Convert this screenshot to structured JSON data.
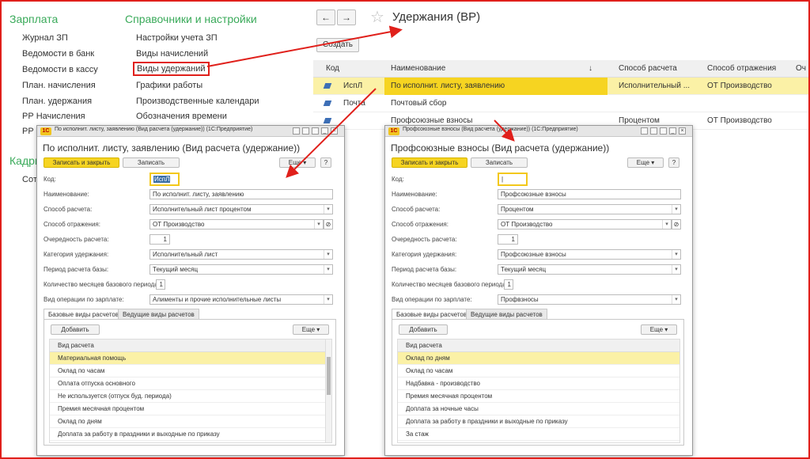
{
  "nav": {
    "section1": "Зарплата",
    "section2": "Справочники и настройки",
    "section3": "Кадры",
    "col1": [
      "Журнал ЗП",
      "Ведомости в банк",
      "Ведомости в кассу",
      "План. начисления",
      "План. удержания",
      "РР Начисления",
      "РР"
    ],
    "col1_last": "Сот",
    "col2": [
      "Настройки учета ЗП",
      "Виды начислений",
      "Виды удержаний",
      "Графики работы",
      "Производственные календари",
      "Обозначения времени"
    ]
  },
  "list": {
    "back": "←",
    "forward": "→",
    "title": "Удержания (ВР)",
    "create": "Создать",
    "headers": [
      "Код",
      "Наименование",
      "Способ расчета",
      "Способ отражения",
      "Оч"
    ],
    "sort_mark": "↓",
    "rows": [
      {
        "code": "ИспЛ",
        "name": "По исполнит. листу, заявлению",
        "method": "Исполнительный ...",
        "reflection": "ОТ Производство"
      },
      {
        "code": "Почта",
        "name": "Почтовый сбор",
        "method": "",
        "reflection": ""
      },
      {
        "code": "",
        "name": "Профсоюзные взносы",
        "method": "Процентом",
        "reflection": "ОТ Производство"
      }
    ]
  },
  "dlg1": {
    "titlebar": "По исполнит. листу, заявлению (Вид расчета (удержание))   (1С:Предприятие)",
    "heading": "По исполнит. листу, заявлению (Вид расчета (удержание))",
    "save_close": "Записать и закрыть",
    "save": "Записать",
    "more": "Еще",
    "help": "?",
    "labels": {
      "code": "Код:",
      "name": "Наименование:",
      "calc": "Способ расчета:",
      "refl": "Способ отражения:",
      "order": "Очередность расчета:",
      "cat": "Категория удержания:",
      "period": "Период расчета базы:",
      "months": "Количество месяцев базового периода:",
      "op": "Вид операции по зарплате:"
    },
    "values": {
      "code": "ИспЛ",
      "name": "По исполнит. листу, заявлению",
      "calc": "Исполнительный лист процентом",
      "refl": "ОТ Производство",
      "order": "1",
      "cat": "Исполнительный лист",
      "period": "Текущий месяц",
      "months": "1",
      "op": "Алименты и прочие исполнительные листы"
    },
    "tab1": "Базовые виды расчетов",
    "tab2": "Ведущие виды расчетов",
    "add": "Добавить",
    "col": "Вид расчета",
    "items": [
      "Материальная помощь",
      "Оклад по часам",
      "Оплата отпуска основного",
      "Не используется (отпуск буд. периода)",
      "Премия месячная процентом",
      "Оклад по дням",
      "Доплата за работу в праздники и выходные по приказу"
    ]
  },
  "dlg2": {
    "titlebar": "Профсоюзные взносы (Вид расчета (удержание))   (1С:Предприятие)",
    "heading": "Профсоюзные взносы (Вид расчета (удержание))",
    "save_close": "Записать и закрыть",
    "save": "Записать",
    "more": "Еще",
    "help": "?",
    "labels": {
      "code": "Код:",
      "name": "Наименование:",
      "calc": "Способ расчета:",
      "refl": "Способ отражения:",
      "order": "Очередность расчета:",
      "cat": "Категория удержания:",
      "period": "Период расчета базы:",
      "months": "Количество месяцев базового периода:",
      "op": "Вид операции по зарплате:"
    },
    "values": {
      "code": "",
      "name": "Профсоюзные взносы",
      "calc": "Процентом",
      "refl": "ОТ Производство",
      "order": "1",
      "cat": "Профсоюзные взносы",
      "period": "Текущий месяц",
      "months": "1",
      "op": "Профвзносы"
    },
    "tab1": "Базовые виды расчетов",
    "tab2": "Ведущие виды расчетов",
    "add": "Добавить",
    "col": "Вид расчета",
    "items": [
      "Оклад по дням",
      "Оклад по часам",
      "Надбавка - производство",
      "Премия месячная процентом",
      "Доплата за ночные часы",
      "Доплата за работу в праздники и выходные по приказу",
      "За стаж"
    ]
  },
  "colors": {
    "accent_green": "#3aaa5a",
    "highlight_yellow": "#f6d421",
    "annotation_red": "#e0201b"
  }
}
